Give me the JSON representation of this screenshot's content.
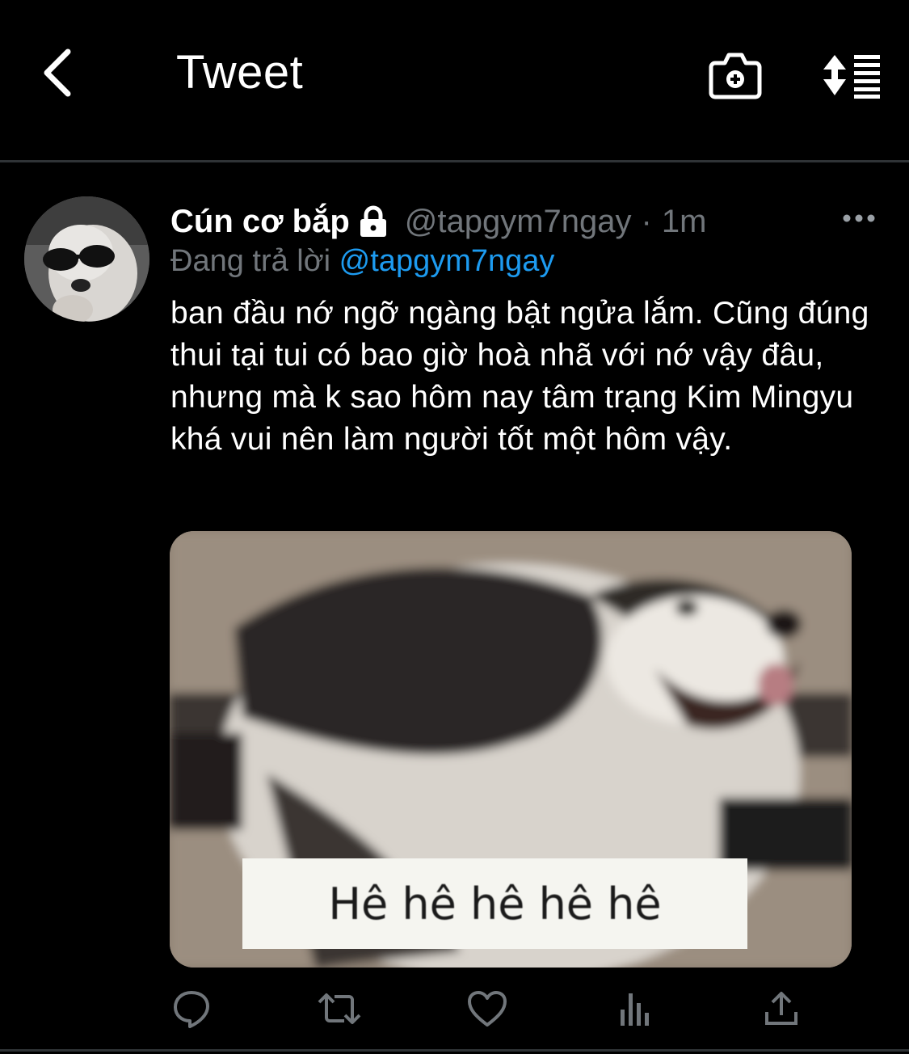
{
  "header": {
    "title": "Tweet",
    "back_icon": "chevron-left-icon",
    "camera_icon": "camera-plus-icon",
    "sort_icon": "sort-list-icon"
  },
  "tweet": {
    "author_name": "Cún cơ bắp",
    "handle": "@tapgym7ngay",
    "separator": "·",
    "time": "1m",
    "protected_icon": "lock-icon",
    "reply_prefix": "Đang trả lời",
    "reply_to": "@tapgym7ngay",
    "text": "ban đầu nớ ngỡ ngàng bật ngửa lắm. Cũng đúng thui tại tui có bao giờ hoà nhã với nớ vậy đâu, nhưng mà k sao hôm nay tâm trạng Kim Mingyu khá vui nên làm người tốt một hôm vậy.",
    "media_caption": "Hê hê hê hê hê"
  },
  "actions": [
    {
      "name": "reply",
      "icon": "reply-bubble-icon"
    },
    {
      "name": "retweet",
      "icon": "retweet-icon"
    },
    {
      "name": "like",
      "icon": "heart-icon"
    },
    {
      "name": "analytics",
      "icon": "analytics-bars-icon"
    },
    {
      "name": "share",
      "icon": "share-upload-icon"
    }
  ],
  "colors": {
    "background": "#000000",
    "text_primary": "#ffffff",
    "text_secondary": "#71767b",
    "accent": "#1d9bf0",
    "divider": "#2f3336"
  }
}
